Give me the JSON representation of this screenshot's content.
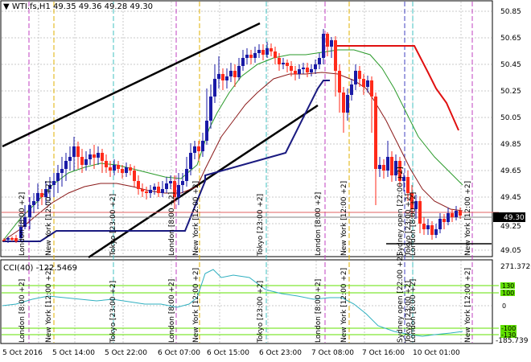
{
  "chart": {
    "symbol_label": "WTI.fs,H1",
    "ohlc_label": "49.35 49.36 49.28 49.30",
    "current_price_label": "49.30",
    "price_scale": [
      "50.85",
      "50.65",
      "50.45",
      "50.25",
      "50.05",
      "49.85",
      "49.65",
      "49.45",
      "49.25",
      "49.05"
    ],
    "time_scale": [
      "5 Oct 2016",
      "5 Oct 14:00",
      "5 Oct 22:00",
      "6 Oct 07:00",
      "6 Oct 15:00",
      "6 Oct 23:00",
      "7 Oct 08:00",
      "7 Oct 16:00",
      "10 Oct 01:00"
    ]
  },
  "cci": {
    "label": "CCI(40)",
    "value": "-122.5469",
    "scale_top": "271.3726",
    "scale_bottom": "-185.739",
    "level_130": "130",
    "level_100": "100",
    "level_0": "0",
    "level_m100": "-100",
    "level_m130": "-130"
  },
  "sessions_top": [
    "London [8:00 +2]",
    "New York [12:00 +2]",
    "Tokyo [23:00 +2]",
    "London [8:00 +2]",
    "New York [12:00 +2]",
    "Tokyo [23:00 +2]",
    "London [8:00 +2]",
    "New York [12:00 +2]",
    "Sydney open [22:00 +2]",
    "Tokyo [23:00 +2]",
    "London [8:00 +2]",
    "New York [12:00 +2]"
  ],
  "sessions_bottom": [
    "London [8:00 +2]",
    "New York [12:00 +2]",
    "Tokyo [23:00 +2]",
    "London [8:00 +2]",
    "New York [12:00 +2]",
    "Tokyo [23:00 +2]",
    "London [8:00 +2]",
    "New York [12:00 +2]",
    "Sydney open [22:00 +2]",
    "Tokyo [23:00 +2]",
    "London [8:00 +2]",
    "New York [12:00 +2]"
  ],
  "colors": {
    "bull": "#1a1aa6",
    "bear": "#ff2a1a",
    "grid": "#c8c8c8",
    "london": "#c040c0",
    "newyork": "#e0b000",
    "tokyo": "#40c0c0",
    "sydney": "#4040c0",
    "ema_fast": "#8b1a1a",
    "ema_slow": "#2a9a2a",
    "cci_line": "#30b0c0",
    "cci_level": "#60e000"
  }
}
